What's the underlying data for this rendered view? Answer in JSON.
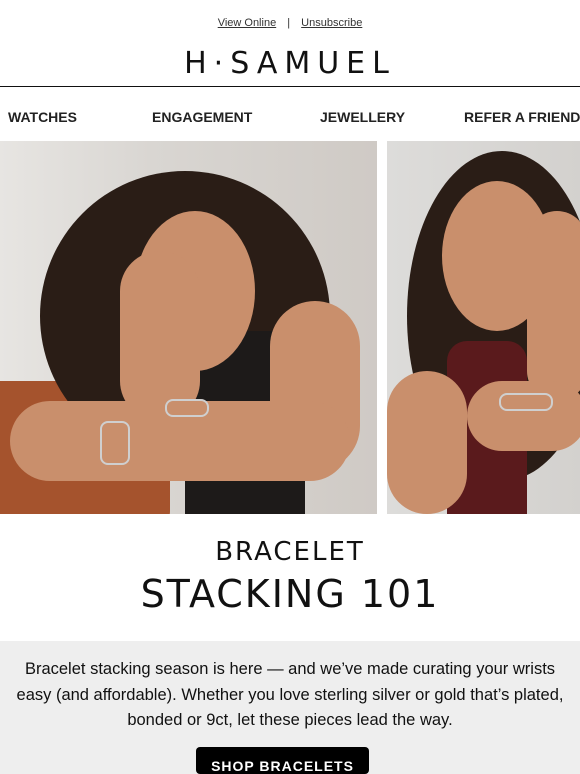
{
  "header": {
    "view_online": "View Online",
    "separator": "|",
    "unsubscribe": "Unsubscribe",
    "logo": "H·SAMUEL"
  },
  "nav": {
    "items": [
      "WATCHES",
      "ENGAGEMENT",
      "JEWELLERY",
      "REFER A FRIEND"
    ]
  },
  "hero": {
    "headline_line1": "BRACELET",
    "headline_line2": "STACKING 101"
  },
  "body": {
    "line1": "Bracelet stacking season is here — and we’ve made curating your wrists",
    "line2": "easy (and affordable). Whether you love sterling silver or gold that’s plated,",
    "line3": "bonded or 9ct, let these pieces lead the way."
  },
  "cta": {
    "label": "SHOP BRACELETS"
  }
}
